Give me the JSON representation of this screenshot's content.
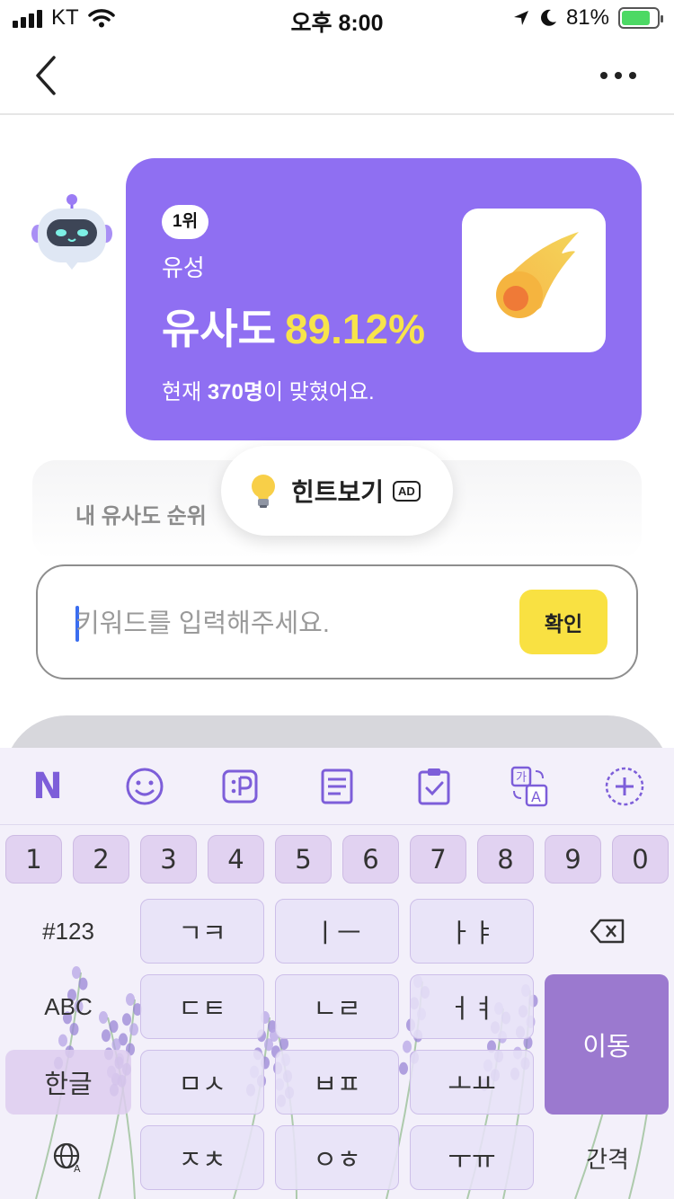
{
  "status_bar": {
    "carrier": "KT",
    "time": "오후 8:00",
    "battery": "81%",
    "battery_level": 0.81
  },
  "result_card": {
    "rank": "1위",
    "word": "유성",
    "similarity_label": "유사도",
    "similarity_value": "89.12%",
    "count_prefix": "현재 ",
    "count_value": "370명",
    "count_suffix": "이 맞혔어요."
  },
  "rank_panel": {
    "title": "내 유사도 순위"
  },
  "hint": {
    "label": "힌트보기",
    "ad": "AD"
  },
  "input": {
    "placeholder": "키워드를 입력해주세요.",
    "value": "",
    "confirm_label": "확인"
  },
  "keyboard": {
    "toolbar_icons": [
      "naver-n-icon",
      "emoji-icon",
      "emoticon-icon",
      "memo-icon",
      "clipboard-icon",
      "translate-icon",
      "add-icon"
    ],
    "toolbar_n": "N",
    "numbers": [
      "1",
      "2",
      "3",
      "4",
      "5",
      "6",
      "7",
      "8",
      "9",
      "0"
    ],
    "row1": [
      "ㄱㅋ",
      "ㅣㅡ",
      "ㅏㅑ"
    ],
    "row2": [
      "ㄷㅌ",
      "ㄴㄹ",
      "ㅓㅕ"
    ],
    "row3": [
      "ㅁㅅ",
      "ㅂㅍ",
      "ㅗㅛ"
    ],
    "row4": [
      "ㅈㅊ",
      "ㅇㅎ",
      "ㅜㅠ"
    ],
    "sym_label": "#123",
    "abc_label": "ABC",
    "hangul_label": "한글",
    "move_label": "이동",
    "space_label": "간격"
  },
  "colors": {
    "accent": "#8f6ff2",
    "highlight": "#f7e44a",
    "confirm": "#f9e142",
    "move_key": "#9b79cf"
  }
}
